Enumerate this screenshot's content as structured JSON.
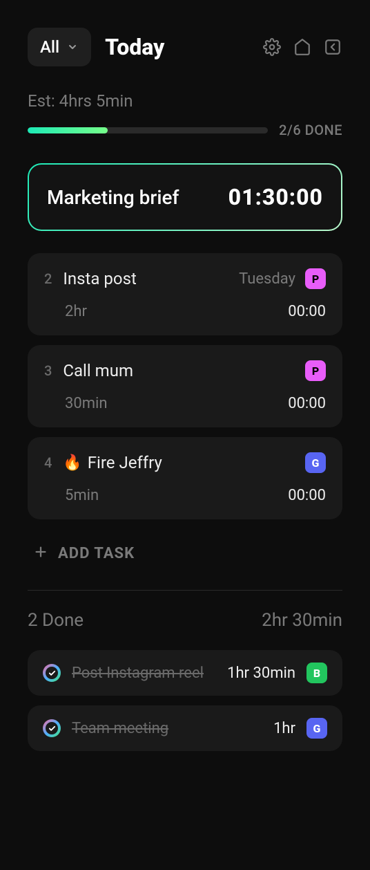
{
  "header": {
    "filter_label": "All",
    "title": "Today"
  },
  "estimate": {
    "label": "Est: 4hrs 5min",
    "progress_text": "2/6 DONE",
    "progress_percent": 33.33
  },
  "active_task": {
    "name": "Marketing brief",
    "time": "01:30:00"
  },
  "tasks": [
    {
      "index": "2",
      "title": "Insta post",
      "meta": "Tuesday",
      "badge": "P",
      "badge_color": "pink",
      "est": "2hr",
      "clock": "00:00",
      "emoji": ""
    },
    {
      "index": "3",
      "title": "Call mum",
      "meta": "",
      "badge": "P",
      "badge_color": "pink",
      "est": "30min",
      "clock": "00:00",
      "emoji": ""
    },
    {
      "index": "4",
      "title": "Fire Jeffry",
      "meta": "",
      "badge": "G",
      "badge_color": "blue",
      "est": "5min",
      "clock": "00:00",
      "emoji": "🔥"
    }
  ],
  "add_task_label": "ADD TASK",
  "done": {
    "count_label": "2 Done",
    "time_label": "2hr 30min",
    "items": [
      {
        "title": "Post Instagram reel",
        "duration": "1hr 30min",
        "badge": "B",
        "badge_color": "green"
      },
      {
        "title": "Team meeting",
        "duration": "1hr",
        "badge": "G",
        "badge_color": "blue"
      }
    ]
  }
}
